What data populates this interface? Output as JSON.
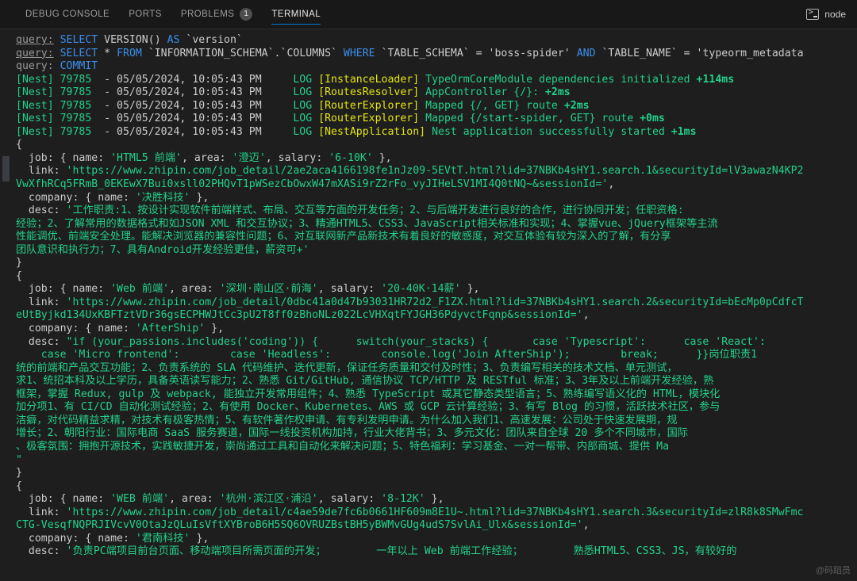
{
  "panel": {
    "tabs": [
      {
        "label": "DEBUG CONSOLE",
        "active": false,
        "badge": null
      },
      {
        "label": "PORTS",
        "active": false,
        "badge": null
      },
      {
        "label": "PROBLEMS",
        "active": false,
        "badge": "1"
      },
      {
        "label": "TERMINAL",
        "active": true,
        "badge": null
      }
    ],
    "shell_label": "node",
    "shell_icon": "terminal-icon"
  },
  "colors": {
    "background": "#1e1e1e",
    "header_background": "#181818",
    "accent": "#0078d4",
    "keyword_blue": "#3b8eea",
    "string_green": "#23d18b",
    "log_yellow": "#e5e510",
    "text_gray": "#cccccc"
  },
  "terminal": {
    "lines": [
      [
        {
          "t": "query:",
          "c": "c-dim c-under"
        },
        {
          "t": " ",
          "c": "c-gray"
        },
        {
          "t": "SELECT",
          "c": "c-blue"
        },
        {
          "t": " VERSION() ",
          "c": "c-gray"
        },
        {
          "t": "AS",
          "c": "c-blue"
        },
        {
          "t": " `version`",
          "c": "c-gray"
        }
      ],
      [
        {
          "t": "query:",
          "c": "c-dim c-under"
        },
        {
          "t": " ",
          "c": "c-gray"
        },
        {
          "t": "SELECT",
          "c": "c-blue"
        },
        {
          "t": " * ",
          "c": "c-gray"
        },
        {
          "t": "FROM",
          "c": "c-blue"
        },
        {
          "t": " `INFORMATION_SCHEMA`.`COLUMNS` ",
          "c": "c-gray"
        },
        {
          "t": "WHERE",
          "c": "c-blue"
        },
        {
          "t": " `TABLE_SCHEMA` = 'boss-spider' ",
          "c": "c-gray"
        },
        {
          "t": "AND",
          "c": "c-blue"
        },
        {
          "t": " `TABLE_NAME` = 'typeorm_metadata",
          "c": "c-gray"
        }
      ],
      [
        {
          "t": "query:",
          "c": "c-dim"
        },
        {
          "t": " ",
          "c": "c-gray"
        },
        {
          "t": "COMMIT",
          "c": "c-blue"
        }
      ],
      [
        {
          "t": "[Nest] 79785  ",
          "c": "c-green"
        },
        {
          "t": "- 05/05/2024, 10:05:43 PM",
          "c": "c-gray"
        },
        {
          "t": "     ",
          "c": "c-gray"
        },
        {
          "t": "LOG",
          "c": "c-green"
        },
        {
          "t": " ",
          "c": "c-gray"
        },
        {
          "t": "[InstanceLoader]",
          "c": "c-yellow"
        },
        {
          "t": " TypeOrmCoreModule dependencies initialized ",
          "c": "c-green"
        },
        {
          "t": "+114ms",
          "c": "c-green c-bold"
        }
      ],
      [
        {
          "t": "[Nest] 79785  ",
          "c": "c-green"
        },
        {
          "t": "- 05/05/2024, 10:05:43 PM",
          "c": "c-gray"
        },
        {
          "t": "     ",
          "c": "c-gray"
        },
        {
          "t": "LOG",
          "c": "c-green"
        },
        {
          "t": " ",
          "c": "c-gray"
        },
        {
          "t": "[RoutesResolver]",
          "c": "c-yellow"
        },
        {
          "t": " AppController {/}: ",
          "c": "c-green"
        },
        {
          "t": "+2ms",
          "c": "c-green c-bold"
        }
      ],
      [
        {
          "t": "[Nest] 79785  ",
          "c": "c-green"
        },
        {
          "t": "- 05/05/2024, 10:05:43 PM",
          "c": "c-gray"
        },
        {
          "t": "     ",
          "c": "c-gray"
        },
        {
          "t": "LOG",
          "c": "c-green"
        },
        {
          "t": " ",
          "c": "c-gray"
        },
        {
          "t": "[RouterExplorer]",
          "c": "c-yellow"
        },
        {
          "t": " Mapped {/, GET} route ",
          "c": "c-green"
        },
        {
          "t": "+2ms",
          "c": "c-green c-bold"
        }
      ],
      [
        {
          "t": "[Nest] 79785  ",
          "c": "c-green"
        },
        {
          "t": "- 05/05/2024, 10:05:43 PM",
          "c": "c-gray"
        },
        {
          "t": "     ",
          "c": "c-gray"
        },
        {
          "t": "LOG",
          "c": "c-green"
        },
        {
          "t": " ",
          "c": "c-gray"
        },
        {
          "t": "[RouterExplorer]",
          "c": "c-yellow"
        },
        {
          "t": " Mapped {/start-spider, GET} route ",
          "c": "c-green"
        },
        {
          "t": "+0ms",
          "c": "c-green c-bold"
        }
      ],
      [
        {
          "t": "[Nest] 79785  ",
          "c": "c-green"
        },
        {
          "t": "- 05/05/2024, 10:05:43 PM",
          "c": "c-gray"
        },
        {
          "t": "     ",
          "c": "c-gray"
        },
        {
          "t": "LOG",
          "c": "c-green"
        },
        {
          "t": " ",
          "c": "c-gray"
        },
        {
          "t": "[NestApplication]",
          "c": "c-yellow"
        },
        {
          "t": " Nest application successfully started ",
          "c": "c-green"
        },
        {
          "t": "+1ms",
          "c": "c-green c-bold"
        }
      ],
      [
        {
          "t": "{",
          "c": "c-gray"
        }
      ],
      [
        {
          "t": "  job: { name: ",
          "c": "c-gray"
        },
        {
          "t": "'HTML5 前端'",
          "c": "c-green cjk"
        },
        {
          "t": ", area: ",
          "c": "c-gray"
        },
        {
          "t": "'澄迈'",
          "c": "c-green cjk"
        },
        {
          "t": ", salary: ",
          "c": "c-gray"
        },
        {
          "t": "'6-10K'",
          "c": "c-green"
        },
        {
          "t": " },",
          "c": "c-gray"
        }
      ],
      [
        {
          "t": "  link: ",
          "c": "c-gray"
        },
        {
          "t": "'https://www.zhipin.com/job_detail/2ae2aca4166198fe1nJz09-5EVtT.html?lid=37NBKb4sHY1.search.1&securityId=lV3awazN4KP2",
          "c": "c-green"
        }
      ],
      [
        {
          "t": "VwXfhRCq5FRmB_0EKEwX7Bui0xsll02PHQvT1pWSezCbOwxW47mXASi9rZ2rFo_vyJIHeLSV1MI4Q0tNQ~&sessionId='",
          "c": "c-green"
        },
        {
          "t": ",",
          "c": "c-gray"
        }
      ],
      [
        {
          "t": "  company: { name: ",
          "c": "c-gray"
        },
        {
          "t": "'决胜科技'",
          "c": "c-green cjk"
        },
        {
          "t": " },",
          "c": "c-gray"
        }
      ],
      [
        {
          "t": "  desc: ",
          "c": "c-gray"
        },
        {
          "t": "'工作职责:1、按设计实现软件前端样式、布局、交互等方面的开发任务；2、与后端开发进行良好的合作，进行协同开发；任职资格:",
          "c": "c-green cjk"
        }
      ],
      [
        {
          "t": "经验；2、了解常用的数据格式和如JSON XML 和交互协议；3、精通HTML5、CSS3、JavaScript相关标准和实现；4、掌握vue、jQuery框架等主流",
          "c": "c-green cjk"
        }
      ],
      [
        {
          "t": "性能调优、前端安全处理。能解决浏览器的兼容性问题；6、对互联网新产品新技术有着良好的敏感度，对交互体验有较为深入的了解，有分享",
          "c": "c-green cjk"
        }
      ],
      [
        {
          "t": "团队意识和执行力；7、具有Android开发经验更佳，薪资可+'",
          "c": "c-green cjk"
        }
      ],
      [
        {
          "t": "}",
          "c": "c-gray"
        }
      ],
      [
        {
          "t": "{",
          "c": "c-gray"
        }
      ],
      [
        {
          "t": "  job: { name: ",
          "c": "c-gray"
        },
        {
          "t": "'Web 前端'",
          "c": "c-green cjk"
        },
        {
          "t": ", area: ",
          "c": "c-gray"
        },
        {
          "t": "'深圳·南山区·前海'",
          "c": "c-green cjk"
        },
        {
          "t": ", salary: ",
          "c": "c-gray"
        },
        {
          "t": "'20-40K·14薪'",
          "c": "c-green cjk"
        },
        {
          "t": " },",
          "c": "c-gray"
        }
      ],
      [
        {
          "t": "  link: ",
          "c": "c-gray"
        },
        {
          "t": "'https://www.zhipin.com/job_detail/0dbc41a0d47b93031HR72d2_F1ZX.html?lid=37NBKb4sHY1.search.2&securityId=bEcMp0pCdfcT",
          "c": "c-green"
        }
      ],
      [
        {
          "t": "eUtByjkd134UxKBFTztVDr36gsECPHWJtCc3pU2T8ff0zBhoNLz022LcVHXqtFYJGH36PdyvctFqnp&sessionId='",
          "c": "c-green"
        },
        {
          "t": ",",
          "c": "c-gray"
        }
      ],
      [
        {
          "t": "  company: { name: ",
          "c": "c-gray"
        },
        {
          "t": "'AfterShip'",
          "c": "c-green"
        },
        {
          "t": " },",
          "c": "c-gray"
        }
      ],
      [
        {
          "t": "  desc: ",
          "c": "c-gray"
        },
        {
          "t": "\"if (your_passions.includes('coding')) {      switch(your_stacks) {       case 'Typescript':      case 'React':",
          "c": "c-green"
        }
      ],
      [
        {
          "t": "    case 'Micro frontend':        case 'Headless':        console.log('Join AfterShip');        break;      }}",
          "c": "c-green"
        },
        {
          "t": "岗位职责1",
          "c": "c-green cjk"
        }
      ],
      [
        {
          "t": "统的前端和产品交互功能；2、负责系统的 SLA 代码维护、迭代更新，保证任务质量和交付及时性；3、负责编写相关的技术文档、单元测试，",
          "c": "c-green cjk"
        }
      ],
      [
        {
          "t": "求1、统招本科及以上学历，具备英语读写能力；2、熟悉 Git/GitHub, 通信协议 TCP/HTTP 及 RESTful 标准；3、3年及以上前端开发经验，熟",
          "c": "c-green cjk"
        }
      ],
      [
        {
          "t": "框架，掌握 Redux, gulp 及 webpack, 能独立开发常用组件；4、熟悉 TypeScript 或其它静态类型语言；5、熟练编写语义化的 HTML，模块化",
          "c": "c-green cjk"
        }
      ],
      [
        {
          "t": "加分项1、有 CI/CD 自动化测试经验；2、有使用 Docker、Kubernetes、AWS 或 GCP 云计算经验；3、有写 Blog 的习惯，活跃技术社区，参与",
          "c": "c-green cjk"
        }
      ],
      [
        {
          "t": "洁癖，对代码精益求精，对技术有极客热情；5、有软件著作权申请、有专利发明申请。为什么加入我们1、高速发展：公司处于快速发展期，规",
          "c": "c-green cjk"
        }
      ],
      [
        {
          "t": "增长；2、朝阳行业：国际电商 SaaS 服务赛道，国际一线投资机构加持，行业大佬背书；3、多元文化：团队来自全球 20 多个不同城市，国际",
          "c": "c-green cjk"
        }
      ],
      [
        {
          "t": "、极客氛围：拥抱开源技术，实践敏捷开发，崇尚通过工具和自动化来解决问题；5、特色福利：学习基金、一对一帮带、内部商城、提供 Ma",
          "c": "c-green cjk"
        }
      ],
      [
        {
          "t": "\"",
          "c": "c-green"
        }
      ],
      [
        {
          "t": "}",
          "c": "c-gray"
        }
      ],
      [
        {
          "t": "{",
          "c": "c-gray"
        }
      ],
      [
        {
          "t": "  job: { name: ",
          "c": "c-gray"
        },
        {
          "t": "'WEB 前端'",
          "c": "c-green cjk"
        },
        {
          "t": ", area: ",
          "c": "c-gray"
        },
        {
          "t": "'杭州·滨江区·浦沿'",
          "c": "c-green cjk"
        },
        {
          "t": ", salary: ",
          "c": "c-gray"
        },
        {
          "t": "'8-12K'",
          "c": "c-green"
        },
        {
          "t": " },",
          "c": "c-gray"
        }
      ],
      [
        {
          "t": "  link: ",
          "c": "c-gray"
        },
        {
          "t": "'https://www.zhipin.com/job_detail/c4ae59de7fc6b0661HF609m8E1U~.html?lid=37NBKb4sHY1.search.3&securityId=zlR8k8SMwFmc",
          "c": "c-green"
        }
      ],
      [
        {
          "t": "CTG-VesqfNQPRJIVcvV0OtaJzQLuIsVftXYBroB6H5SQ6OVRUZBstBH5yBWMvGUg4udS7SvlAi_Ulx&sessionId='",
          "c": "c-green"
        },
        {
          "t": ",",
          "c": "c-gray"
        }
      ],
      [
        {
          "t": "  company: { name: ",
          "c": "c-gray"
        },
        {
          "t": "'君南科技'",
          "c": "c-green cjk"
        },
        {
          "t": " },",
          "c": "c-gray"
        }
      ],
      [
        {
          "t": "  desc: ",
          "c": "c-gray"
        },
        {
          "t": "'负责PC端项目前台页面、移动端项目所需页面的开发；        一年以上 Web 前端工作经验；        熟悉HTML5、CSS3、JS，有较好的",
          "c": "c-green cjk"
        }
      ]
    ],
    "watermark": "@码蹈员"
  }
}
